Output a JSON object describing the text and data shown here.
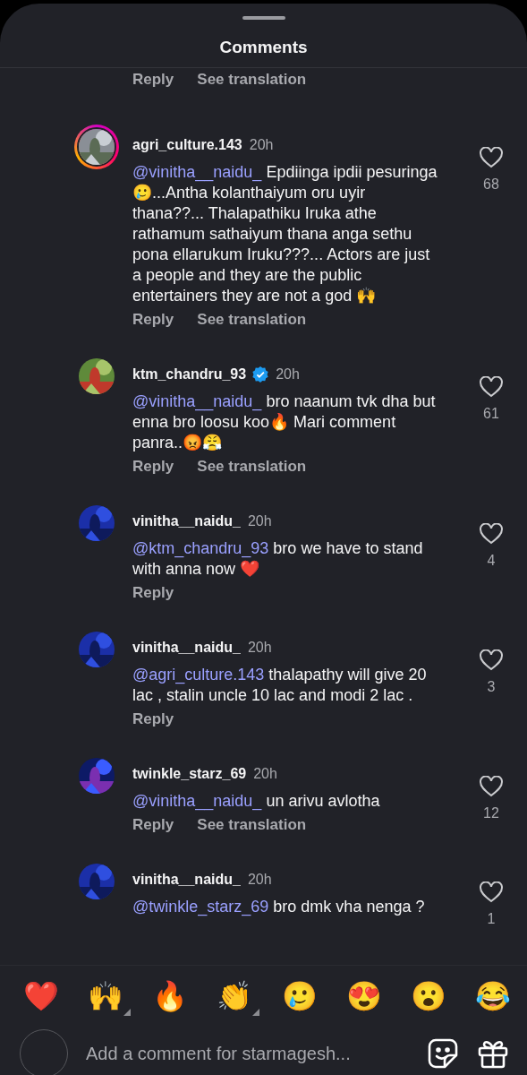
{
  "sheet": {
    "title": "Comments"
  },
  "top_actions": [
    "Reply",
    "See translation"
  ],
  "comments": [
    {
      "username": "agri_culture.143",
      "verified": false,
      "story_ring": true,
      "time": "20h",
      "mention": "@vinitha__naidu_",
      "text": " Epdiinga ipdii pesuringa🥲...Antha kolanthaiyum oru uyir thana??... Thalapathiku Iruka athe rathamum sathaiyum thana anga sethu pona ellarukum Iruku???... Actors are just a people and they are the public entertainers they are not a god 🙌",
      "likes": "68",
      "actions": [
        "Reply",
        "See translation"
      ]
    },
    {
      "username": "ktm_chandru_93",
      "verified": true,
      "story_ring": false,
      "time": "20h",
      "mention": "@vinitha__naidu_",
      "text": " bro naanum tvk dha but enna bro loosu koo🔥 Mari comment panra..😡😤",
      "likes": "61",
      "actions": [
        "Reply",
        "See translation"
      ]
    },
    {
      "username": "vinitha__naidu_",
      "verified": false,
      "story_ring": false,
      "time": "20h",
      "mention": "@ktm_chandru_93",
      "text": " bro we have to stand with anna now ❤️",
      "likes": "4",
      "actions": [
        "Reply"
      ]
    },
    {
      "username": "vinitha__naidu_",
      "verified": false,
      "story_ring": false,
      "time": "20h",
      "mention": "@agri_culture.143",
      "text": " thalapathy will give 20 lac , stalin uncle 10 lac and modi 2 lac .",
      "likes": "3",
      "actions": [
        "Reply"
      ]
    },
    {
      "username": "twinkle_starz_69",
      "verified": false,
      "story_ring": false,
      "time": "20h",
      "mention": "@vinitha__naidu_",
      "text": " un arivu avlotha",
      "likes": "12",
      "actions": [
        "Reply",
        "See translation"
      ]
    },
    {
      "username": "vinitha__naidu_",
      "verified": false,
      "story_ring": false,
      "time": "20h",
      "mention": "@twinkle_starz_69",
      "text": " bro dmk vha nenga ?",
      "likes": "1"
    }
  ],
  "reactions": [
    {
      "emoji": "❤️",
      "has_variants": false
    },
    {
      "emoji": "🙌",
      "has_variants": true
    },
    {
      "emoji": "🔥",
      "has_variants": false
    },
    {
      "emoji": "👏",
      "has_variants": true
    },
    {
      "emoji": "🥲",
      "has_variants": false
    },
    {
      "emoji": "😍",
      "has_variants": false
    },
    {
      "emoji": "😮",
      "has_variants": false
    },
    {
      "emoji": "😂",
      "has_variants": false
    }
  ],
  "composer": {
    "placeholder": "Add a comment for starmagesh..."
  }
}
